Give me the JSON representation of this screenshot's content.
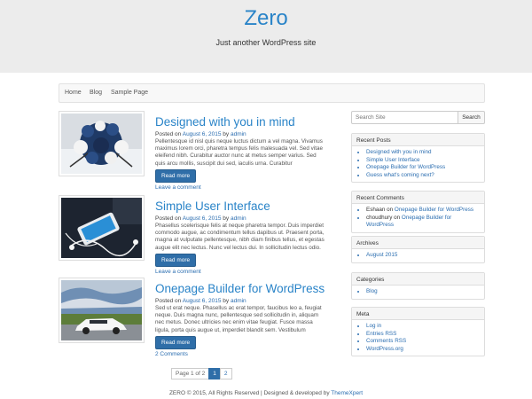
{
  "site": {
    "title": "Zero",
    "tagline": "Just another WordPress site"
  },
  "nav": [
    "Home",
    "Blog",
    "Sample Page"
  ],
  "posts": [
    {
      "title": "Designed with you in mind",
      "posted_on": "Posted on",
      "date": "August 6, 2015",
      "by": "by",
      "author": "admin",
      "excerpt": "Pellentesque id nisl quis neque luctus dictum a vel magna. Vivamus maximus lorem orci, pharetra tempus felis malesuada vel. Sed vitae eleifend nibh. Curabitur auctor nunc at metus semper varius. Sed quis arcu mollis, suscipit dui sed, iaculis urna. Curabitur",
      "read_more": "Read more",
      "comments": "Leave a comment"
    },
    {
      "title": "Simple User Interface",
      "posted_on": "Posted on",
      "date": "August 6, 2015",
      "by": "by",
      "author": "admin",
      "excerpt": "Phasellus scelerisque felis at neque pharetra tempor. Duis imperdiet commodo augue, ac condimentum tellus dapibus ut. Praesent porta, magna at vulputate pellentesque, nibh diam finibus tellus, et egestas augue elit nec lectus. Nunc vel lectus dui. In sollicitudin lectus odio.",
      "read_more": "Read more",
      "comments": "Leave a comment"
    },
    {
      "title": "Onepage Builder for WordPress",
      "posted_on": "Posted on",
      "date": "August 6, 2015",
      "by": "by",
      "author": "admin",
      "excerpt": "Sed ut erat neque. Phasellus ac erat tempor, faucibus leo a, feugiat neque. Duis magna nunc, pellentesque sed sollicitudin in, aliquam nec metus. Donec ultricies nec enim vitae feugiat. Fusce massa ligula, porta quis augue ut, imperdiet blandit sem. Vestibulum",
      "read_more": "Read more",
      "comments": "2 Comments"
    }
  ],
  "pagination": {
    "label": "Page 1 of 2",
    "pages": [
      "1",
      "2"
    ]
  },
  "footer": {
    "text": "ZERO © 2015, All Rights Reserved | Designed & developed by",
    "link": "ThemeXpert"
  },
  "sidebar": {
    "search_placeholder": "Search Site",
    "search_button": "Search",
    "recent_posts": {
      "title": "Recent Posts",
      "items": [
        "Designed with you in mind",
        "Simple User Interface",
        "Onepage Builder for WordPress",
        "Guess what's coming next?"
      ]
    },
    "recent_comments": {
      "title": "Recent Comments",
      "items": [
        {
          "author": "Eshaan",
          "on": "on",
          "post": "Onepage Builder for WordPress"
        },
        {
          "author": "choudhury",
          "on": "on",
          "post": "Onepage Builder for WordPress"
        }
      ]
    },
    "archives": {
      "title": "Archives",
      "items": [
        "August 2015"
      ]
    },
    "categories": {
      "title": "Categories",
      "items": [
        "Blog"
      ]
    },
    "meta": {
      "title": "Meta",
      "items": [
        "Log in",
        "Entries RSS",
        "Comments RSS",
        "WordPress.org"
      ]
    }
  },
  "colors": {
    "title_blue": "#2a84c8",
    "button_blue": "#2f6ea8",
    "link_blue": "#2a6db0",
    "header_bg": "#ececec"
  }
}
